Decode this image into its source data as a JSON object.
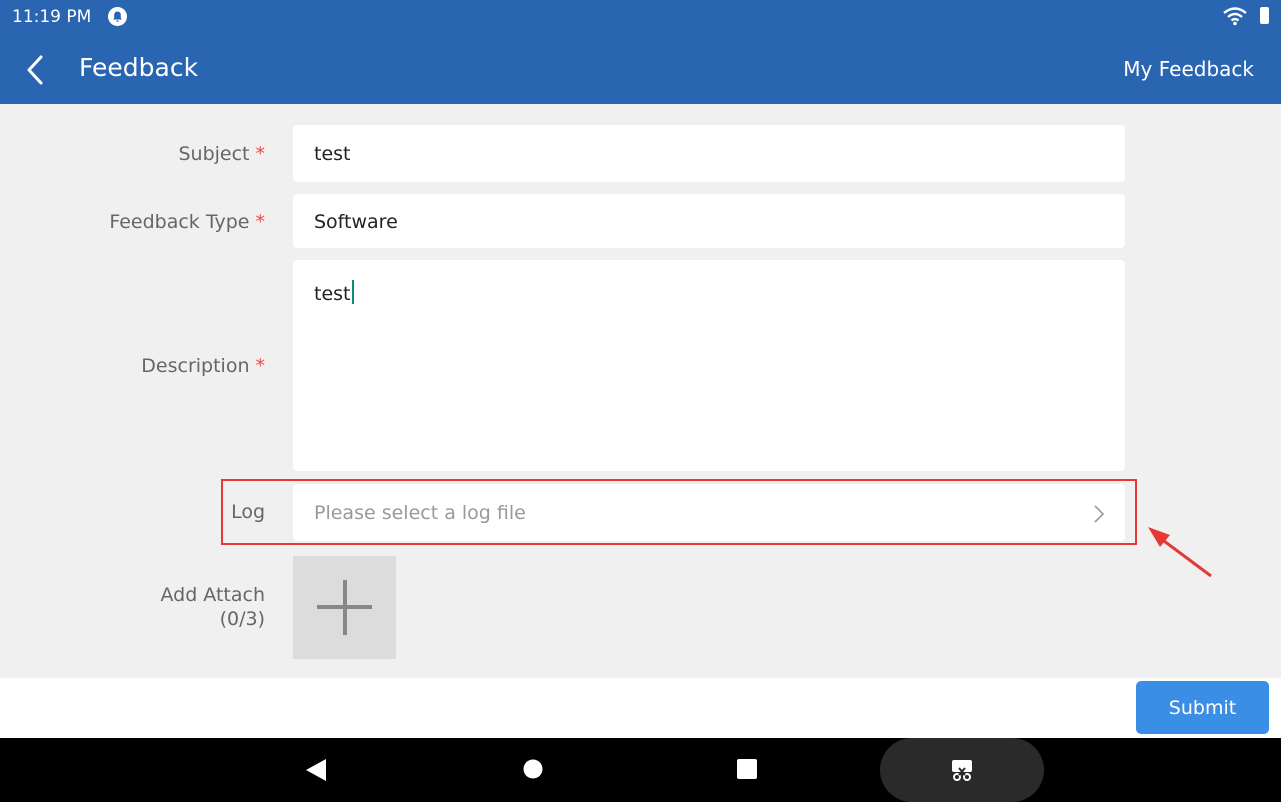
{
  "status_bar": {
    "time": "11:19 PM"
  },
  "header": {
    "title": "Feedback",
    "my_feedback_label": "My Feedback"
  },
  "form": {
    "subject": {
      "label": "Subject",
      "required_mark": "*",
      "value": "test"
    },
    "feedback_type": {
      "label": "Feedback Type",
      "required_mark": "*",
      "value": "Software"
    },
    "description": {
      "label": "Description",
      "required_mark": "*",
      "value": "test"
    },
    "log": {
      "label": "Log",
      "placeholder": "Please select a log file"
    },
    "attach": {
      "label": "Add Attach",
      "count": "(0/3)"
    }
  },
  "submit_label": "Submit",
  "colors": {
    "primary": "#2965b1",
    "accent": "#3a8ee6",
    "required": "#e84b4b",
    "annotation": "#e53935"
  },
  "icons": [
    "back-arrow-icon",
    "chevron-right-icon",
    "plus-icon",
    "wifi-icon",
    "battery-icon",
    "notification-icon",
    "nav-back-icon",
    "nav-home-icon",
    "nav-recents-icon",
    "screenshot-icon"
  ]
}
